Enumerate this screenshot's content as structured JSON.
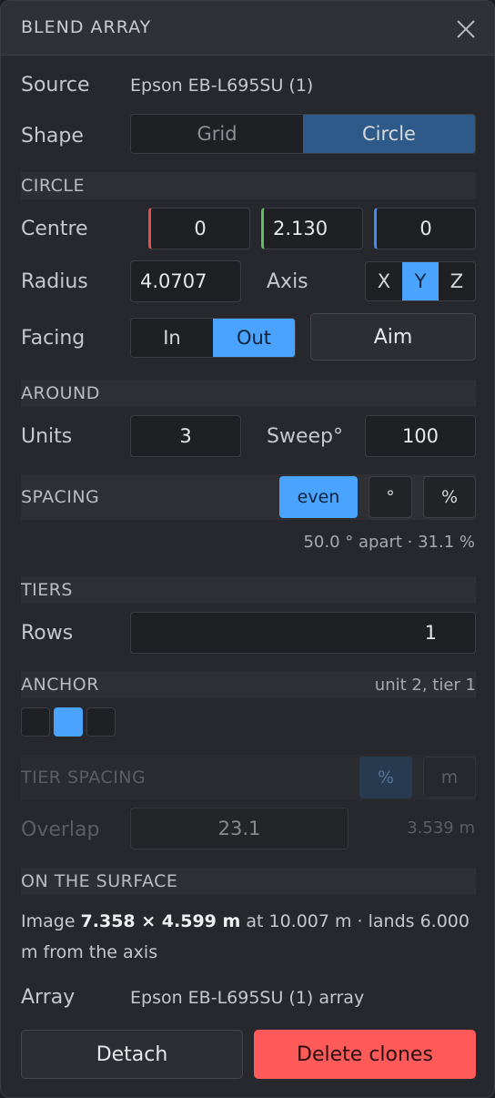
{
  "title": "BLEND ARRAY",
  "source": {
    "label": "Source",
    "value": "Epson EB-L695SU (1)"
  },
  "shape": {
    "label": "Shape",
    "options": [
      "Grid",
      "Circle"
    ],
    "selected": "Circle"
  },
  "circle": {
    "header": "CIRCLE",
    "centre": {
      "label": "Centre",
      "x": "0",
      "y": "2.130",
      "z": "0"
    },
    "radius": {
      "label": "Radius",
      "value": "4.0707"
    },
    "axis": {
      "label": "Axis",
      "options": [
        "X",
        "Y",
        "Z"
      ],
      "selected": "Y"
    },
    "facing": {
      "label": "Facing",
      "options": [
        "In",
        "Out"
      ],
      "selected": "Out",
      "aim_label": "Aim"
    }
  },
  "around": {
    "header": "AROUND",
    "units": {
      "label": "Units",
      "value": "3"
    },
    "sweep": {
      "label": "Sweep°",
      "value": "100"
    }
  },
  "spacing": {
    "header": "SPACING",
    "even_label": "even",
    "degree_label": "°",
    "percent_label": "%",
    "summary": "50.0 ° apart · 31.1 %"
  },
  "tiers": {
    "header": "TIERS",
    "rows": {
      "label": "Rows",
      "value": "1"
    }
  },
  "anchor": {
    "header": "ANCHOR",
    "status": "unit 2, tier 1",
    "selected_index": 1,
    "count": 3
  },
  "tier_spacing": {
    "header": "TIER SPACING",
    "percent_label": "%",
    "m_label": "m",
    "overlap": {
      "label": "Overlap",
      "value": "23.1",
      "readout": "3.539 m"
    }
  },
  "surface": {
    "header": "ON THE SURFACE",
    "line_prefix": "Image ",
    "dimensions": "7.358 × 4.599 m",
    "line_rest_1": " at 10.007 m · lands 6.000",
    "line_rest_2": "m from the axis"
  },
  "array": {
    "label": "Array",
    "value": "Epson EB-L695SU (1) array"
  },
  "actions": {
    "detach_label": "Detach",
    "delete_label": "Delete clones"
  },
  "colors": {
    "accent": "#4aa3ff",
    "selected_dim": "#2e5a8a",
    "danger": "#ff5a5a",
    "axis_x": "#e0524f",
    "axis_y": "#5fbf5a",
    "axis_z": "#3d8ef0"
  }
}
